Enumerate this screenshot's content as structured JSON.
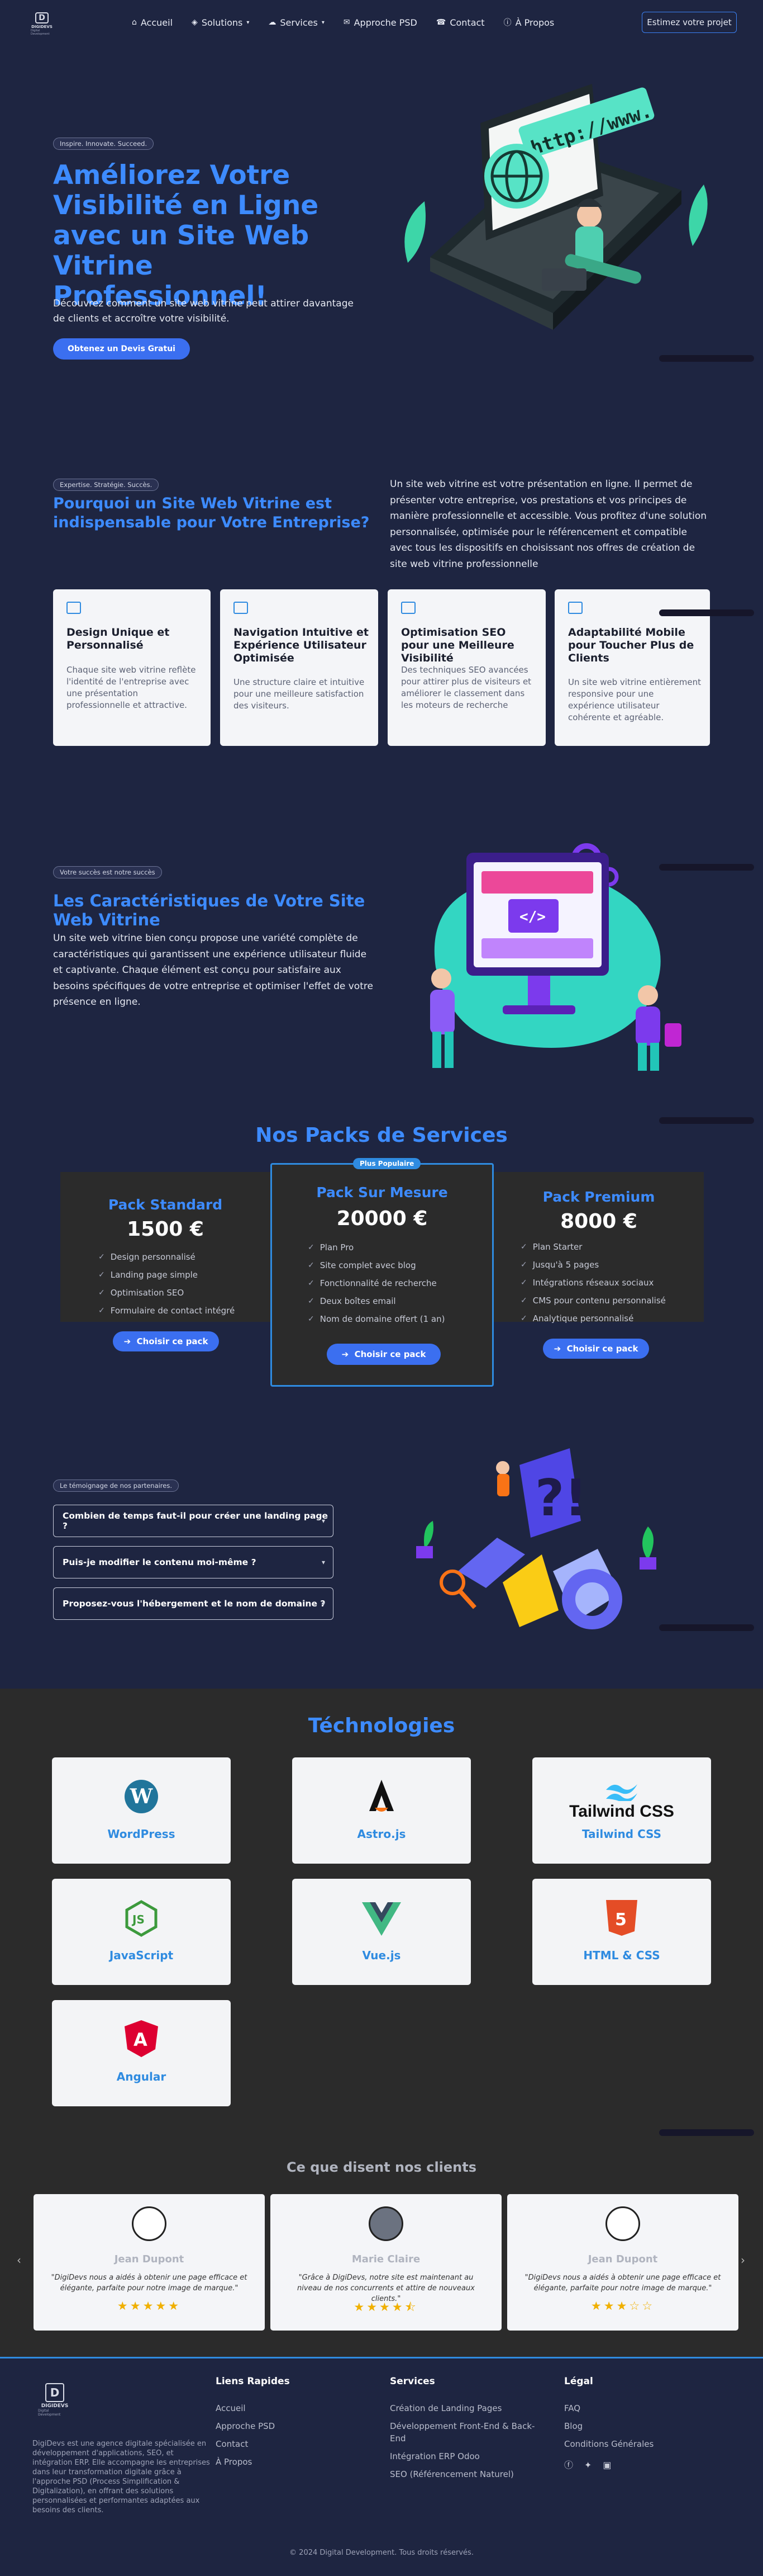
{
  "header": {
    "logo_text": "DIGIDEVS",
    "logo_sub": "Digital Development",
    "nav": [
      {
        "label": "Accueil",
        "icon": "home-icon"
      },
      {
        "label": "Solutions",
        "icon": "cube-icon"
      },
      {
        "label": "Services",
        "icon": "cloud-icon"
      },
      {
        "label": "Approche PSD",
        "icon": "chat-icon"
      },
      {
        "label": "Contact",
        "icon": "phone-icon"
      },
      {
        "label": "À Propos",
        "icon": "info-icon"
      }
    ],
    "cta": "Estimez votre projet"
  },
  "hero": {
    "pill": "Inspire. Innovate. Succeed.",
    "title": "Améliorez Votre Visibilité en Ligne avec un Site Web Vitrine Professionnel!",
    "desc": "Découvrez comment un site web vitrine peut attirer davantage de clients et accroître votre visibilité.",
    "button": "Obtenez un Devis Gratui",
    "illustration_text": "http://www."
  },
  "why": {
    "pill": "Expertise. Stratégie. Succès.",
    "title": "Pourquoi un Site Web Vitrine est indispensable pour Votre Entreprise?",
    "desc": "Un site web vitrine est votre présentation en ligne. Il permet de présenter votre entreprise, vos prestations et vos principes de manière professionnelle et accessible. Vous profitez d'une solution personnalisée, optimisée pour le référencement et compatible avec tous les dispositifs en choisissant nos offres de création de site web vitrine professionnelle",
    "cards": [
      {
        "title": "Design Unique et Personnalisé",
        "text": "Chaque site web vitrine reflète l'identité de l'entreprise avec une présentation professionnelle et attractive."
      },
      {
        "title": "Navigation Intuitive et Expérience Utilisateur Optimisée",
        "text": "Une structure claire et intuitive pour une meilleure satisfaction des visiteurs."
      },
      {
        "title": "Optimisation SEO pour une Meilleure Visibilité",
        "text": "Des techniques SEO avancées pour attirer plus de visiteurs et améliorer le classement dans les moteurs de recherche"
      },
      {
        "title": "Adaptabilité Mobile pour Toucher Plus de Clients",
        "text": "Un site web vitrine entièrement responsive pour une expérience utilisateur cohérente et agréable."
      }
    ]
  },
  "features": {
    "pill": "Votre succès est notre succès",
    "title": "Les Caractéristiques de Votre Site Web Vitrine",
    "desc": "Un site web vitrine bien conçu propose une variété complète de caractéristiques qui garantissent une expérience utilisateur fluide et captivante. Chaque élément est conçu pour satisfaire aux besoins spécifiques de votre entreprise et optimiser l'effet de votre présence en ligne."
  },
  "packs": {
    "title": "Nos Packs de Services",
    "badge": "Plus Populaire",
    "button": "Choisir ce pack",
    "items": [
      {
        "name": "Pack Standard",
        "price": "1500 €",
        "features": [
          "Design personnalisé",
          "Landing page simple",
          "Optimisation SEO",
          "Formulaire de contact intégré"
        ]
      },
      {
        "name": "Pack Sur Mesure",
        "price": "20000 €",
        "features": [
          "Plan Pro",
          "Site complet avec blog",
          "Fonctionnalité de recherche",
          "Deux boîtes email",
          "Nom de domaine offert (1 an)"
        ]
      },
      {
        "name": "Pack Premium",
        "price": "8000 €",
        "features": [
          "Plan Starter",
          "Jusqu'à 5 pages",
          "Intégrations réseaux sociaux",
          "CMS pour contenu personnalisé",
          "Analytique personnalisé"
        ]
      }
    ]
  },
  "faq": {
    "pill": "Le témoignage de nos partenaires.",
    "items": [
      "Combien de temps faut-il pour créer une landing page ?",
      "Puis-je modifier le contenu moi-même ?",
      "Proposez-vous l'hébergement et le nom de domaine ?"
    ]
  },
  "tech": {
    "title": "Téchnologies",
    "items": [
      {
        "label": "WordPress",
        "icon": "wordpress-icon",
        "color": "#21759b"
      },
      {
        "label": "Astro.js",
        "icon": "astro-icon",
        "color": "#111111"
      },
      {
        "label": "Tailwind CSS",
        "icon": "tailwind-icon",
        "color": "#38bdf8",
        "logo_text": "Tailwind CSS"
      },
      {
        "label": "JavaScript",
        "icon": "nodejs-icon",
        "color": "#3c9a3c"
      },
      {
        "label": "Vue.js",
        "icon": "vue-icon",
        "color": "#41b883"
      },
      {
        "label": "HTML & CSS",
        "icon": "html5-icon",
        "color": "#e44d26"
      },
      {
        "label": "Angular",
        "icon": "angular-icon",
        "color": "#dd0031"
      }
    ]
  },
  "testimonials": {
    "title": "Ce que disent nos clients",
    "items": [
      {
        "name": "Jean Dupont",
        "quote": "\"DigiDevs nous a aidés à obtenir une page efficace et élégante, parfaite pour notre image de marque.\"",
        "stars": "★★★★★",
        "rating": 5
      },
      {
        "name": "Marie Claire",
        "quote": "\"Grâce à DigiDevs, notre site est maintenant au niveau de nos concurrents et attire de nouveaux clients.\"",
        "stars": "★★★★⯪",
        "rating": 4.5
      },
      {
        "name": "Jean Dupont",
        "quote": "\"DigiDevs nous a aidés à obtenir une page efficace et élégante, parfaite pour notre image de marque.\"",
        "stars": "★★★☆☆",
        "rating": 3
      }
    ],
    "prev": "‹",
    "next": "›"
  },
  "footer": {
    "about": "DigiDevs est une agence digitale spécialisée en développement d'applications, SEO, et intégration ERP. Elle accompagne les entreprises dans leur transformation digitale grâce à l'approche PSD (Process Simplification & Digitalization), en offrant des solutions personnalisées et performantes adaptées aux besoins des clients.",
    "cols": [
      {
        "title": "Liens Rapides",
        "links": [
          "Accueil",
          "Approche PSD",
          "Contact",
          "À Propos"
        ]
      },
      {
        "title": "Services",
        "links": [
          "Création de Landing Pages",
          "Développement Front-End & Back-End",
          "Intégration ERP Odoo",
          "SEO (Référencement Naturel)"
        ]
      },
      {
        "title": "Légal",
        "links": [
          "FAQ",
          "Blog",
          "Conditions Générales"
        ]
      }
    ],
    "copyright": "© 2024 Digital Development. Tous droits réservés."
  }
}
